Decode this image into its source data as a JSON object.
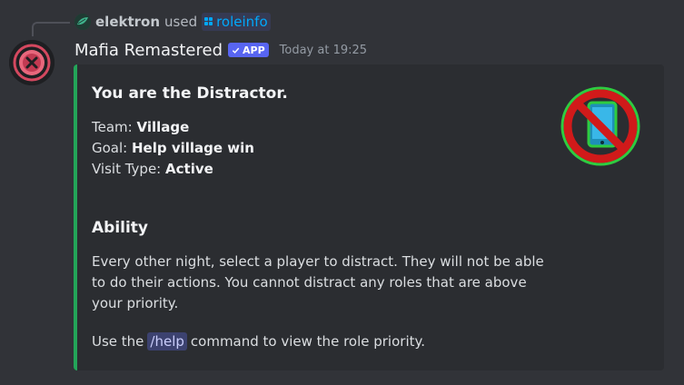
{
  "reply": {
    "user": "elektron",
    "used_text": "used",
    "command": "roleinfo"
  },
  "header": {
    "bot_name": "Mafia Remastered",
    "badge": "APP",
    "timestamp": "Today at 19:25"
  },
  "embed": {
    "title": "You are the Distractor.",
    "team_label": "Team:",
    "team_value": "Village",
    "goal_label": "Goal:",
    "goal_value": "Help village win",
    "visit_label": "Visit Type:",
    "visit_value": "Active",
    "ability_title": "Ability",
    "ability_text": "Every other night, select a player to distract. They will not be able to do their actions. You cannot distract any roles that are above your priority.",
    "help_prefix": "Use the",
    "help_command": "/help",
    "help_suffix": "command to view the role priority.",
    "accent_color": "#23a559",
    "thumbnail_icon": "no-phone-icon"
  }
}
